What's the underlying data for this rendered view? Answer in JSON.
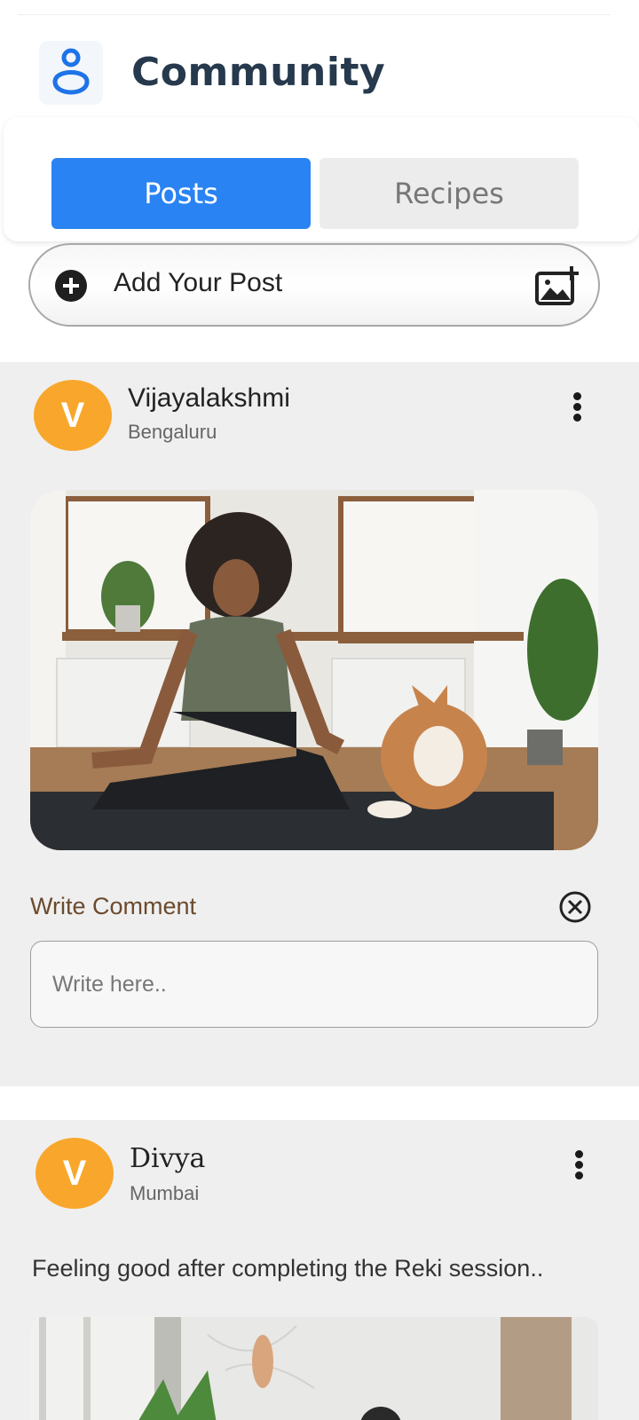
{
  "app": {
    "title": "Community"
  },
  "tabs": [
    {
      "label": "Posts",
      "active": true
    },
    {
      "label": "Recipes",
      "active": false
    }
  ],
  "add_post": {
    "label": "Add Your Post",
    "icon": "add-image-icon"
  },
  "posts": [
    {
      "avatar_letter": "V",
      "name": "Vijayalakshmi",
      "location": "Bengaluru",
      "comment": {
        "title": "Write Comment",
        "placeholder": "Write here.."
      }
    },
    {
      "avatar_letter": "V",
      "name": "Divya",
      "location": "Mumbai",
      "caption": "Feeling good after completing the Reki session.."
    }
  ],
  "colors": {
    "accent": "#2a83f2",
    "avatar": "#f8a72c",
    "title": "#26394d",
    "comment_title": "#6b4a2e"
  }
}
